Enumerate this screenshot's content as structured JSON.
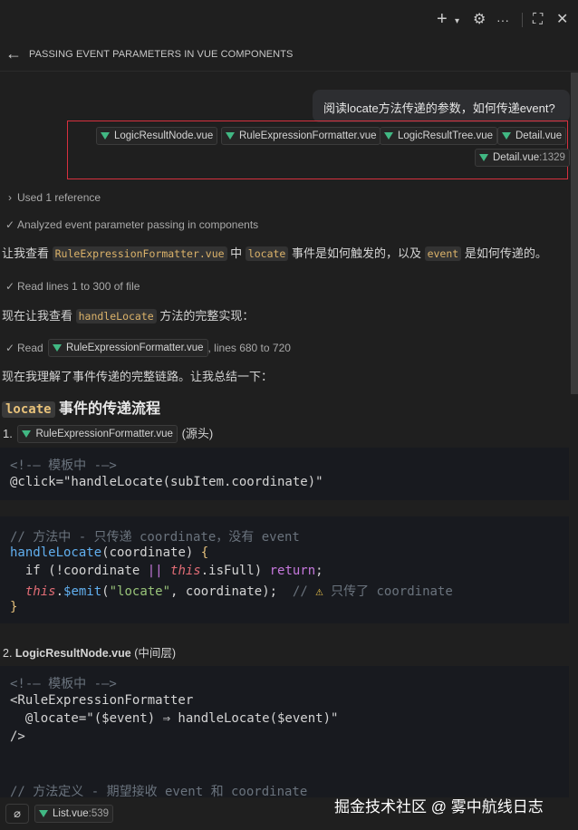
{
  "header": {
    "title": "PASSING EVENT PARAMETERS IN VUE COMPONENTS"
  },
  "user_message": "阅读locate方法传递的参数，如何传递event?",
  "attachments": [
    {
      "name": "LogicResultNode.vue"
    },
    {
      "name": "RuleExpressionFormatter.vue"
    },
    {
      "name": "LogicResultTree.vue"
    },
    {
      "name": "Detail.vue"
    },
    {
      "name": "Detail.vue",
      "line": ":1329"
    }
  ],
  "steps": {
    "used_reference": "Used 1 reference",
    "analyzed": "Analyzed event parameter passing in components",
    "read_lines": "Read lines 1 to 300 of file",
    "read_label": "Read",
    "read_file": "RuleExpressionFormatter.vue",
    "read_range": ", lines 680 to 720"
  },
  "para1": {
    "a": "让我查看 ",
    "code1": "RuleExpressionFormatter.vue",
    "b": " 中 ",
    "code2": "locate",
    "c": " 事件是如何触发的，以及 ",
    "code3": "event",
    "d": " 是如何传递的。"
  },
  "para2": {
    "a": "现在让我查看 ",
    "code": "handleLocate",
    "b": " 方法的完整实现："
  },
  "para3": "现在我理解了事件传递的完整链路。让我总结一下：",
  "section_heading": {
    "code": "locate",
    "text": " 事件的传递流程"
  },
  "item1": {
    "num": "1.",
    "file": "RuleExpressionFormatter.vue",
    "suffix": "(源头)"
  },
  "item2": {
    "num": "2.",
    "file": "LogicResultNode.vue",
    "suffix": " (中间层)"
  },
  "code1": {
    "l1": "<!-— 模板中 -—>",
    "l2": "@click=\"handleLocate(subItem.coordinate)\""
  },
  "code2": {
    "l1": "// 方法中 - 只传递 coordinate，没有 event",
    "l2_fn": "handleLocate",
    "l2_rest": "(coordinate) ",
    "l2_brace": "{",
    "l3_a": "  if (!coordinate ",
    "l3_op": "||",
    "l3_sp": " ",
    "l3_this": "this",
    "l3_b": ".isFull) ",
    "l3_kw": "return",
    "l3_c": ";",
    "l4_this": "  this",
    "l4_dot": ".",
    "l4_emit": "$emit",
    "l4_a": "(",
    "l4_str": "\"locate\"",
    "l4_b": ", coordinate);  ",
    "l4_cm": "// ",
    "l4_warn": "⚠",
    "l4_cm2": " 只传了 coordinate",
    "l5": "}"
  },
  "code3": {
    "l1": "<!-— 模板中 -—>",
    "l2": "<RuleExpressionFormatter",
    "l3": "  @locate=\"($event) ⇒ handleLocate($event)\"",
    "l4": "/>",
    "l5": "// 方法定义 - 期望接收 event 和 coordinate"
  },
  "footer_chip": {
    "name": "List.vue",
    "line": ":539"
  },
  "watermark": "掘金技术社区 @ 雾中航线日志",
  "colors": {
    "accent_border": "#d6303e",
    "vue_green": "#41b883",
    "code_bg": "#181a1f"
  }
}
